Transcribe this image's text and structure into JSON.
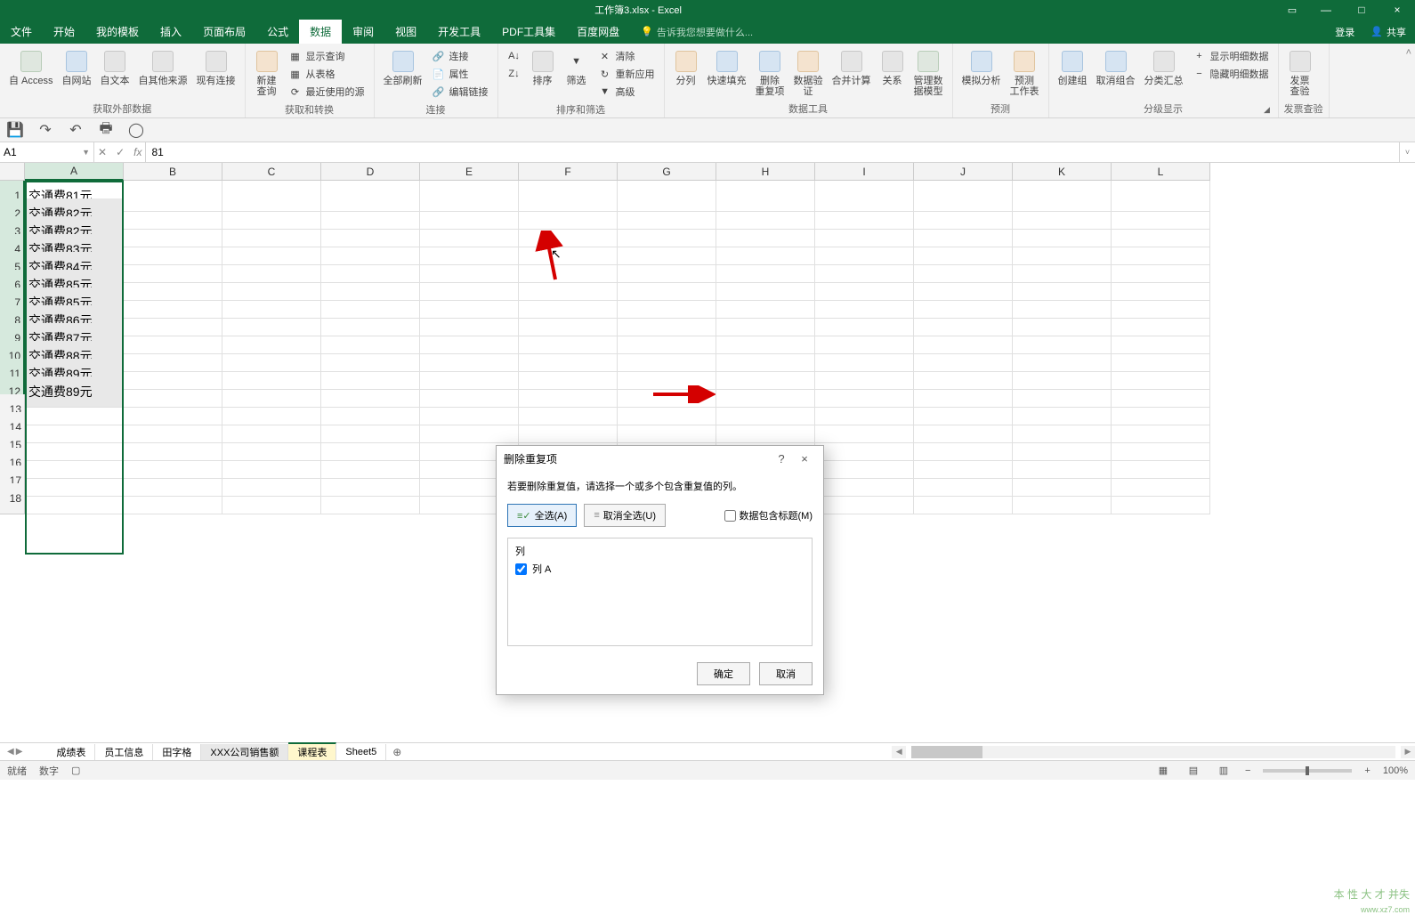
{
  "title": {
    "doc": "工作簿3.xlsx",
    "app": "Excel"
  },
  "win_controls": {
    "minimize": "—",
    "maximize": "□",
    "close": "×"
  },
  "tabs": {
    "file": "文件",
    "home": "开始",
    "templates": "我的模板",
    "insert": "插入",
    "layout": "页面布局",
    "formulas": "公式",
    "data": "数据",
    "review": "审阅",
    "view": "视图",
    "devtools": "开发工具",
    "pdf": "PDF工具集",
    "baidu": "百度网盘"
  },
  "tell_me": "告诉我您想要做什么...",
  "login": "登录",
  "share": "共享",
  "ribbon": {
    "external": {
      "access": "自 Access",
      "web": "自网站",
      "text": "自文本",
      "other": "自其他来源",
      "existing": "现有连接",
      "label": "获取外部数据"
    },
    "get_transform": {
      "new_query": "新建\n查询",
      "show_query": "显示查询",
      "from_table": "从表格",
      "recent": "最近使用的源",
      "label": "获取和转换"
    },
    "connections": {
      "refresh": "全部刷新",
      "connections": "连接",
      "properties": "属性",
      "edit_links": "编辑链接",
      "label": "连接"
    },
    "sort_filter": {
      "sort_az": "A↓Z",
      "sort_za": "Z↓A",
      "sort": "排序",
      "filter": "筛选",
      "clear": "清除",
      "reapply": "重新应用",
      "advanced": "高级",
      "label": "排序和筛选"
    },
    "data_tools": {
      "text_to_col": "分列",
      "flash_fill": "快速填充",
      "remove_dup": "删除\n重复项",
      "data_validation": "数据验\n证",
      "consolidate": "合并计算",
      "relationships": "关系",
      "manage_model": "管理数\n据模型",
      "label": "数据工具"
    },
    "forecast": {
      "whatif": "模拟分析",
      "forecast": "预测\n工作表",
      "label": "预测"
    },
    "outline": {
      "group": "创建组",
      "ungroup": "取消组合",
      "subtotal": "分类汇总",
      "show_detail": "显示明细数据",
      "hide_detail": "隐藏明细数据",
      "label": "分级显示"
    },
    "invoice": {
      "check": "发票\n查验",
      "label": "发票查验"
    }
  },
  "formula_bar": {
    "name_box": "A1",
    "value": "81",
    "fx": "fx"
  },
  "columns": [
    "A",
    "B",
    "C",
    "D",
    "E",
    "F",
    "G",
    "H",
    "I",
    "J",
    "K",
    "L"
  ],
  "rows": {
    "data": [
      "交通费81元",
      "交通费82元",
      "交通费82元",
      "交通费83元",
      "交通费84元",
      "交通费85元",
      "交通费85元",
      "交通费86元",
      "交通费87元",
      "交通费88元",
      "交通费89元",
      "交通费89元"
    ],
    "blank": [
      13,
      14,
      15,
      16,
      17,
      18
    ]
  },
  "dialog": {
    "title": "删除重复项",
    "desc": "若要删除重复值，请选择一个或多个包含重复值的列。",
    "select_all": "全选(A)",
    "deselect_all": "取消全选(U)",
    "has_header": "数据包含标题(M)",
    "list_header": "列",
    "list_item": "列 A",
    "ok": "确定",
    "cancel": "取消",
    "help": "?",
    "close": "×"
  },
  "sheet_tabs": {
    "t1": "成绩表",
    "t2": "员工信息",
    "t3": "田字格",
    "t4": "XXX公司销售额",
    "t5": "课程表",
    "t6": "Sheet5",
    "add": "⊕"
  },
  "statusbar": {
    "ready": "就绪",
    "numfmt": "数字",
    "zoom_minus": "−",
    "zoom_plus": "+",
    "zoom": "100%"
  },
  "watermark": {
    "line1": "本 性 大 才 并失",
    "line2": "www.xz7.com"
  }
}
